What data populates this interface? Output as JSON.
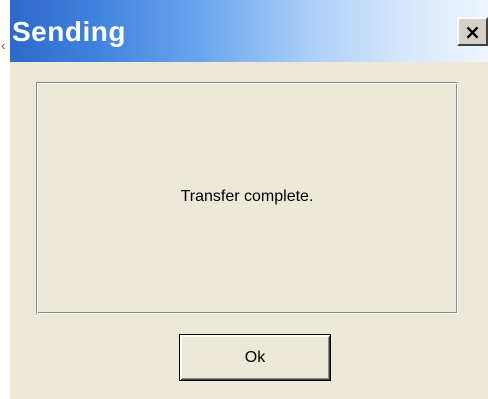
{
  "dialog": {
    "title": "Sending",
    "close_icon": "close-icon",
    "close_glyph": "×",
    "message": "Transfer complete.",
    "ok_label": "Ok"
  },
  "colors": {
    "title_bar_start": "#2f69c9",
    "title_bar_end": "#eef5fd",
    "dialog_background": "#ece9d8",
    "title_text": "#ffffff"
  }
}
